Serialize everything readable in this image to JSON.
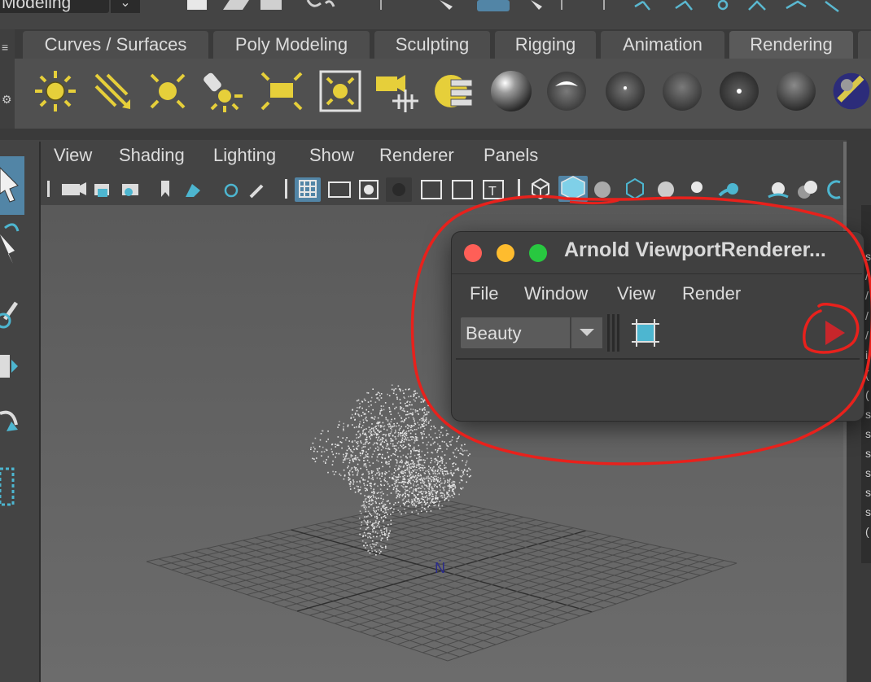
{
  "top_toolbar": {
    "mode_label": "Modeling"
  },
  "shelf": {
    "tabs": [
      "Curves / Surfaces",
      "Poly Modeling",
      "Sculpting",
      "Rigging",
      "Animation",
      "Rendering"
    ],
    "active_tab": "Rendering",
    "icons": [
      "directional-light-icon",
      "area-light-icon",
      "point-light-icon",
      "spot-light-icon",
      "area-light-rect-icon",
      "volume-light-icon",
      "camera-aim-icon",
      "hypershade-icon",
      "blinn-material-icon",
      "phong-material-icon",
      "phong-e-material-icon",
      "lambert-material-icon",
      "anisotropic-material-icon",
      "ramp-material-icon",
      "layered-material-icon"
    ]
  },
  "viewport": {
    "menu": [
      "View",
      "Shading",
      "Lighting",
      "Show",
      "Renderer",
      "Panels"
    ]
  },
  "arnold_window": {
    "title": "Arnold ViewportRenderer...",
    "menu": [
      "File",
      "Window",
      "View",
      "Render"
    ],
    "aov_selected": "Beauty"
  },
  "right_panel": {
    "letters": [
      "s",
      "/",
      "/",
      "/",
      "/",
      "/",
      "i",
      "(",
      "(",
      "/",
      "s",
      "s",
      "s",
      "s",
      "s",
      "s",
      "s",
      "s",
      "("
    ]
  },
  "colors": {
    "accent_blue": "#5285a6",
    "light_yellow": "#e6cf3a",
    "annotation_red": "#e8211c",
    "play_red": "#c8262b",
    "viewport_bg": "#6b6b6b"
  }
}
